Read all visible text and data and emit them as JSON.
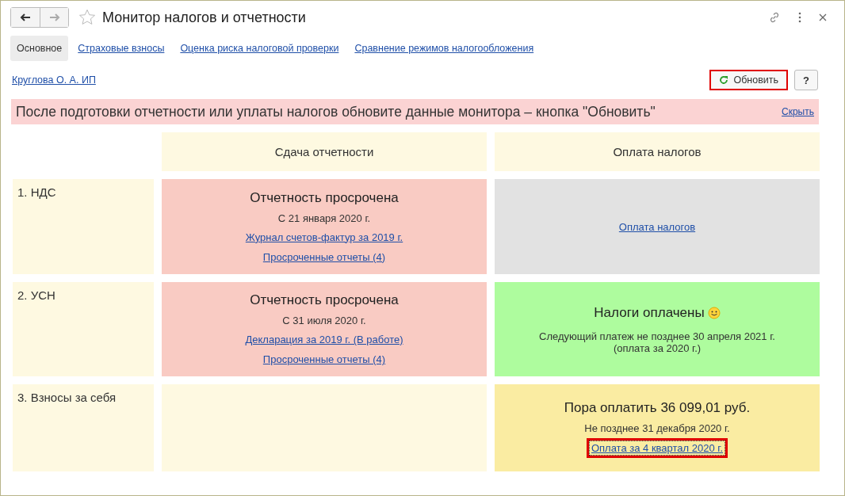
{
  "window": {
    "title": "Монитор налогов и отчетности"
  },
  "tabs": [
    {
      "label": "Основное",
      "selected": true
    },
    {
      "label": "Страховые взносы",
      "selected": false
    },
    {
      "label": "Оценка риска налоговой проверки",
      "selected": false
    },
    {
      "label": "Сравнение режимов налогообложения",
      "selected": false
    }
  ],
  "organization_link": "Круглова О. А. ИП",
  "refresh_button": {
    "label": "Обновить",
    "highlighted": true
  },
  "help_button": "?",
  "notice": {
    "text": "После подготовки отчетности или уплаты налогов обновите данные монитора – кнопка \"Обновить\"",
    "hide_link": "Скрыть"
  },
  "columns": [
    "Сдача отчетности",
    "Оплата налогов"
  ],
  "rows": [
    {
      "label": "1. НДС",
      "cells": [
        {
          "color": "#f9cbc3",
          "lines": [
            {
              "kind": "title",
              "text": "Отчетность просрочена"
            },
            {
              "kind": "text",
              "text": "С 21 января 2020 г."
            },
            {
              "kind": "link",
              "text": "Журнал счетов-фактур за 2019 г.",
              "highlighted": false
            },
            {
              "kind": "link",
              "text": "Просроченные отчеты (4)",
              "highlighted": false
            }
          ]
        },
        {
          "color": "#e2e2e2",
          "lines": [
            {
              "kind": "link",
              "text": "Оплата налогов",
              "highlighted": false
            }
          ]
        }
      ]
    },
    {
      "label": "2. УСН",
      "cells": [
        {
          "color": "#f9cbc3",
          "lines": [
            {
              "kind": "title",
              "text": "Отчетность просрочена"
            },
            {
              "kind": "text",
              "text": "С 31 июля 2020 г."
            },
            {
              "kind": "link",
              "text": "Декларация за 2019 г. (В работе)",
              "highlighted": false
            },
            {
              "kind": "link",
              "text": "Просроченные отчеты (4)",
              "highlighted": false
            }
          ]
        },
        {
          "color": "#aefc9e",
          "lines": [
            {
              "kind": "title_smile",
              "text": "Налоги оплачены"
            },
            {
              "kind": "text",
              "text": "Следующий платеж не позднее 30 апреля 2021 г."
            },
            {
              "kind": "text_tight",
              "text": "(оплата за 2020 г.)"
            }
          ]
        }
      ]
    },
    {
      "label": "3. Взносы за себя",
      "cells": [
        {
          "color": "#fef9e1"
        },
        {
          "color": "#faeca2",
          "lines": [
            {
              "kind": "title",
              "text": "Пора оплатить 36 099,01 руб."
            },
            {
              "kind": "text",
              "text": "Не позднее 31 декабря 2020 г."
            },
            {
              "kind": "link",
              "text": "Оплата за 4 квартал 2020 г.",
              "highlighted": true
            }
          ]
        }
      ]
    }
  ]
}
